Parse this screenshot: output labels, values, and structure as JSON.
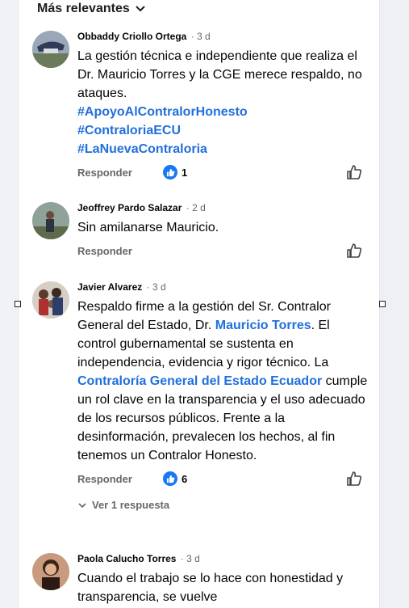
{
  "sort": {
    "label": "Más relevantes"
  },
  "comments": [
    {
      "author": "Obbaddy Criollo Ortega",
      "time": "· 3 d",
      "text": "La gestión técnica e independiente que realiza el Dr. Mauricio Torres y la CGE merece respaldo, no ataques.",
      "hashtags": [
        "#ApoyoAlContralorHonesto",
        "#ContraloriaECU",
        "#LaNuevaContraloria"
      ],
      "reply_label": "Responder",
      "reaction_count": "1"
    },
    {
      "author": "Jeoffrey Pardo Salazar",
      "time": "· 2 d",
      "text": "Sin amilanarse Mauricio.",
      "reply_label": "Responder"
    },
    {
      "author": "Javier Alvarez",
      "time": "· 3 d",
      "text_part1": "Respaldo firme a la gestión del Sr. Contralor General del Estado, Dr. ",
      "mention1": "Mauricio Torres",
      "text_part2": ". El control gubernamental se sustenta en independencia, evidencia y rigor técnico. La ",
      "mention2": "Contraloría General del Estado Ecuador",
      "text_part3": " cumple un rol clave en la transparencia y el uso adecuado de los recursos públicos. Frente a la desinformación, prevalecen los hechos, al fin tenemos un Contralor Honesto.",
      "reply_label": "Responder",
      "reaction_count": "6",
      "view_replies": "Ver 1 respuesta"
    },
    {
      "author": "Paola Calucho Torres",
      "time": "· 3 d",
      "text": "Cuando el trabajo se lo hace con honestidad y transparencia, se vuelve"
    }
  ],
  "colors": {
    "link": "#216fdb",
    "reaction": "#1877f2",
    "muted": "#65676b"
  }
}
